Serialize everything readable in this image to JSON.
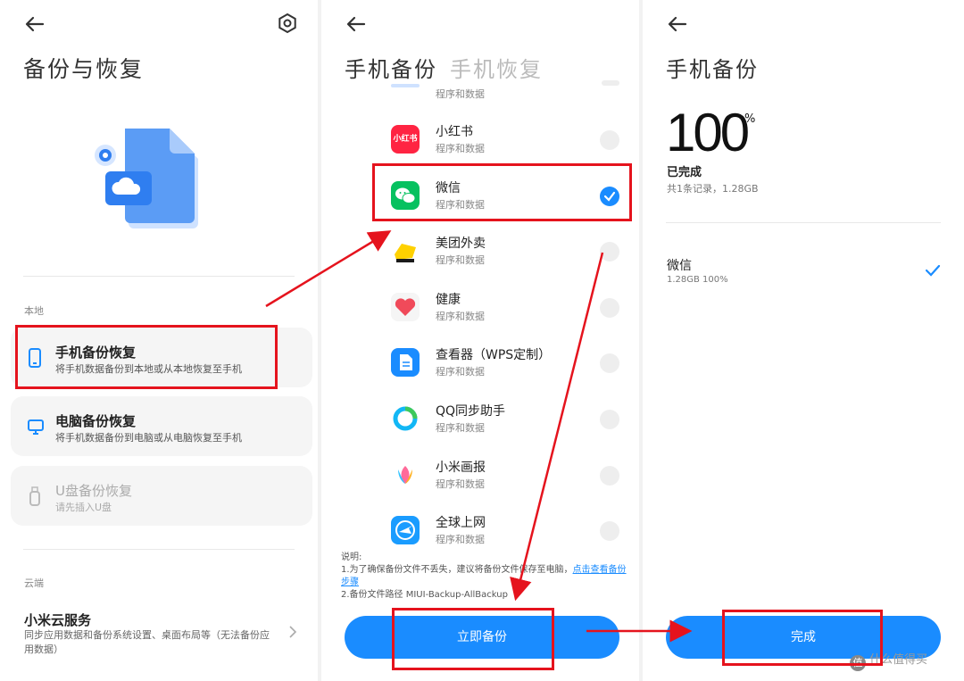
{
  "colors": {
    "accent": "#1a8cff",
    "annotation_red": "#e5131d"
  },
  "screen1": {
    "title": "备份与恢复",
    "settings_icon": "gear-icon",
    "local_label": "本地",
    "cards": [
      {
        "icon": "phone-icon",
        "title": "手机备份恢复",
        "subtitle": "将手机数据备份到本地或从本地恢复至手机"
      },
      {
        "icon": "monitor-icon",
        "title": "电脑备份恢复",
        "subtitle": "将手机数据备份到电脑或从电脑恢复至手机"
      },
      {
        "icon": "usb-icon",
        "title": "U盘备份恢复",
        "subtitle": "请先插入U盘"
      }
    ],
    "cloud_label": "云端",
    "cloud_title": "小米云服务",
    "cloud_subtitle": "同步应用数据和备份系统设置、桌面布局等（无法备份应用数据）"
  },
  "screen2": {
    "tab_active": "手机备份",
    "tab_inactive": "手机恢复",
    "partial_top_sub": "程序和数据",
    "apps": [
      {
        "name": "小红书",
        "sub": "程序和数据",
        "checked": false,
        "icon": "xiaohongshu-icon",
        "icon_text": "小红书",
        "color": "#ff2442"
      },
      {
        "name": "微信",
        "sub": "程序和数据",
        "checked": true,
        "icon": "wechat-icon",
        "icon_text": "",
        "color": "#07c160"
      },
      {
        "name": "美团外卖",
        "sub": "程序和数据",
        "checked": false,
        "icon": "meituan-icon",
        "icon_text": "",
        "color": "#ffd100"
      },
      {
        "name": "健康",
        "sub": "程序和数据",
        "checked": false,
        "icon": "health-icon",
        "icon_text": "",
        "color": "#f5f5f5"
      },
      {
        "name": "查看器（WPS定制）",
        "sub": "程序和数据",
        "checked": false,
        "icon": "wps-viewer-icon",
        "icon_text": "",
        "color": "#1a8cff"
      },
      {
        "name": "QQ同步助手",
        "sub": "程序和数据",
        "checked": false,
        "icon": "qq-sync-icon",
        "icon_text": "",
        "color": "#ffffff"
      },
      {
        "name": "小米画报",
        "sub": "程序和数据",
        "checked": false,
        "icon": "mi-pictorial-icon",
        "icon_text": "",
        "color": "#ffffff"
      },
      {
        "name": "全球上网",
        "sub": "程序和数据",
        "checked": false,
        "icon": "global-internet-icon",
        "icon_text": "",
        "color": "#1a9cff"
      }
    ],
    "note_title": "说明:",
    "note_line1": "1.为了确保备份文件不丢失，建议将备份文件保存至电脑，",
    "note_link": "点击查看备份步骤",
    "note_line2": "2.备份文件路径 MIUI-Backup-AllBackup",
    "button_label": "立即备份"
  },
  "screen3": {
    "title": "手机备份",
    "percent": "100",
    "percent_sign": "%",
    "status": "已完成",
    "summary": "共1条记录，1.28GB",
    "result_name": "微信",
    "result_detail": "1.28GB 100%",
    "button_label": "完成"
  },
  "watermark": {
    "icon_text": "值",
    "text": "什么值得买"
  }
}
